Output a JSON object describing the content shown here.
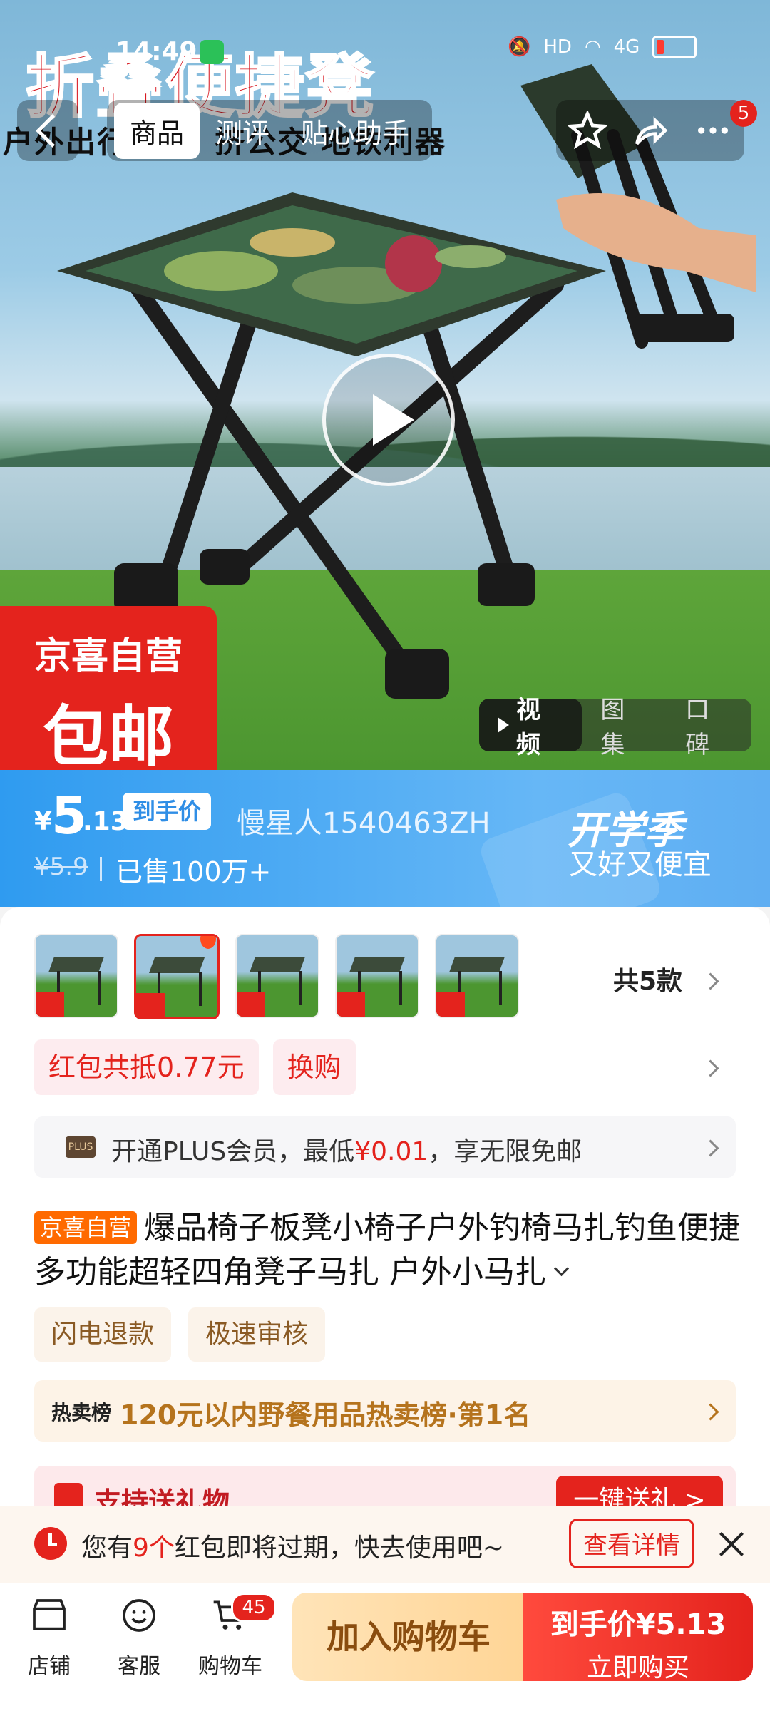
{
  "status_bar": {
    "time": "14:49",
    "network": "4G",
    "hd": "HD"
  },
  "nav": {
    "tabs": [
      "商品",
      "测评",
      "贴心助手"
    ],
    "notification_count": "5"
  },
  "hero": {
    "title": "折叠便捷凳",
    "subtitle": "户外出行  垂钓 挤公交 地铁利器",
    "badge_line1": "京喜自营",
    "badge_line2": "包邮",
    "media_tabs": [
      "视频",
      "图集",
      "口碑"
    ]
  },
  "price": {
    "currency": "¥",
    "integer": "5",
    "decimal": ".13",
    "tag": "到手价",
    "seller": "慢星人1540463ZH",
    "original": "¥5.9",
    "sold": "已售100万+",
    "campaign_title": "开学季",
    "campaign_sub": "又好又便宜"
  },
  "variants": {
    "label": "共5款"
  },
  "coupons": {
    "red_packet": "红包共抵0.77元",
    "exchange": "换购"
  },
  "plus": {
    "icon_text": "PLUS",
    "prefix": "开通PLUS会员，最低",
    "price": "¥0.01",
    "suffix": "，享无限免邮"
  },
  "product": {
    "badge": "京喜自营",
    "title": "爆品椅子板凳小椅子户外钓椅马扎钓鱼便捷多功能超轻四角凳子马扎 户外小马扎"
  },
  "services": [
    "闪电退款",
    "极速审核"
  ],
  "ranking": {
    "label": "热卖榜",
    "text": "120元以内野餐用品热卖榜·第1名"
  },
  "gift": {
    "text": "支持送礼物",
    "button": "一键送礼 >"
  },
  "expire": {
    "prefix": "您有",
    "count": "9个",
    "suffix": "红包即将过期，快去使用吧~",
    "button": "查看详情"
  },
  "bottom": {
    "shop": "店铺",
    "service": "客服",
    "cart": "购物车",
    "cart_count": "45",
    "add_cart": "加入购物车",
    "buy_line1": "到手价¥5.13",
    "buy_line2": "立即购买"
  }
}
